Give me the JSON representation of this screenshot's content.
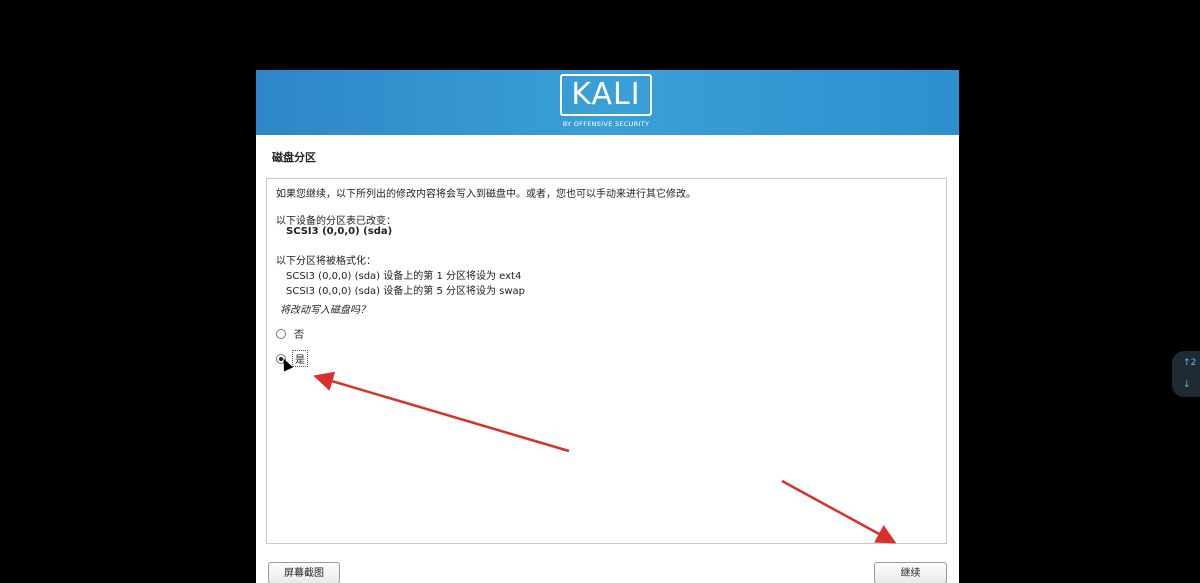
{
  "banner": {
    "logo_text": "KALI",
    "logo_subtitle": "BY OFFENSIVE SECURITY"
  },
  "page": {
    "title": "磁盘分区"
  },
  "content": {
    "intro": "如果您继续，以下所列出的修改内容将会写入到磁盘中。或者，您也可以手动来进行其它修改。",
    "table_changed_heading": "以下设备的分区表已改变：",
    "table_changed_device": "SCSI3 (0,0,0) (sda)",
    "format_heading": "以下分区将被格式化：",
    "format_items": [
      "SCSI3 (0,0,0) (sda) 设备上的第 1 分区将设为 ext4",
      "SCSI3 (0,0,0) (sda) 设备上的第 5 分区将设为 swap"
    ],
    "question": "将改动写入磁盘吗？",
    "options": [
      {
        "label": "否",
        "selected": false
      },
      {
        "label": "是",
        "selected": true
      }
    ]
  },
  "buttons": {
    "screenshot": "屏幕截图",
    "continue": "继续"
  },
  "side_widget": {
    "up_text": "↑2",
    "down_text": "↓"
  },
  "colors": {
    "banner_blue": "#3aa0d6",
    "annotation_red": "#d9302c"
  }
}
